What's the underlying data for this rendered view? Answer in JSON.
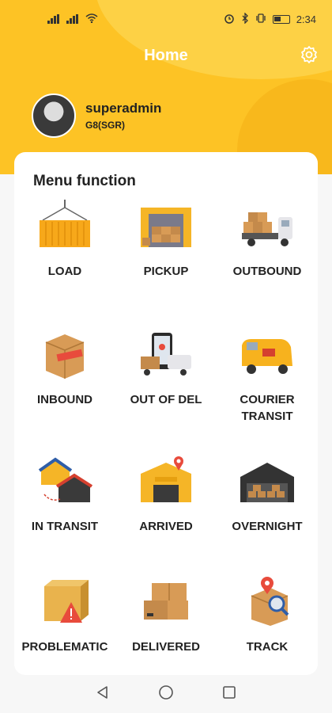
{
  "status": {
    "time": "2:34"
  },
  "header": {
    "title": "Home",
    "settings_icon": "gear-icon"
  },
  "profile": {
    "username": "superadmin",
    "branch": "G8(SGR)"
  },
  "menu": {
    "title": "Menu function",
    "items": [
      {
        "label": "LOAD",
        "icon": "container-icon"
      },
      {
        "label": "PICKUP",
        "icon": "warehouse-boxes-icon"
      },
      {
        "label": "OUTBOUND",
        "icon": "truck-icon"
      },
      {
        "label": "INBOUND",
        "icon": "parcel-icon"
      },
      {
        "label": "OUT OF DEL",
        "icon": "phone-van-icon"
      },
      {
        "label": "COURIER\nTRANSIT",
        "icon": "courier-van-icon"
      },
      {
        "label": "IN TRANSIT",
        "icon": "transit-buildings-icon"
      },
      {
        "label": "ARRIVED",
        "icon": "arrival-warehouse-icon"
      },
      {
        "label": "OVERNIGHT",
        "icon": "storage-shed-icon"
      },
      {
        "label": "PROBLEMATIC",
        "icon": "warning-box-icon"
      },
      {
        "label": "DELIVERED",
        "icon": "delivered-boxes-icon"
      },
      {
        "label": "TRACK",
        "icon": "track-search-icon"
      }
    ]
  },
  "colors": {
    "brand": "#fdc325",
    "accent_dark": "#f8b81c"
  },
  "navbar": {
    "icons": [
      "back-icon",
      "home-icon",
      "recents-icon"
    ]
  }
}
